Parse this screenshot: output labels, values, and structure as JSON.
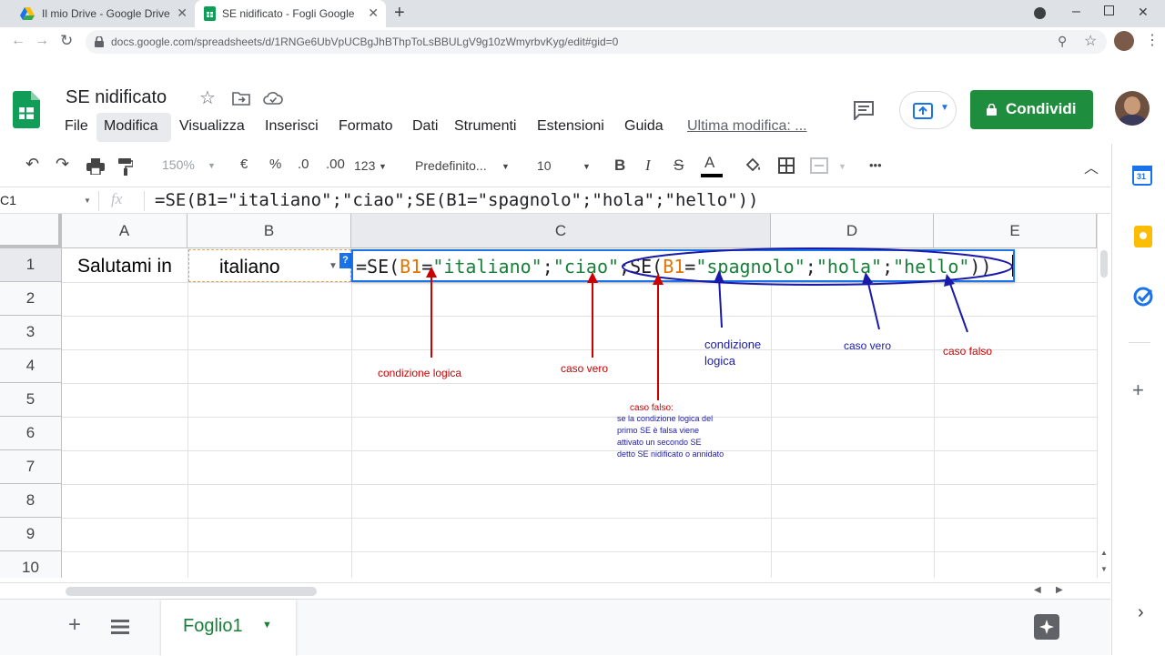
{
  "browser": {
    "tabs": [
      {
        "title": "Il mio Drive - Google Drive"
      },
      {
        "title": "SE nidificato - Fogli Google"
      }
    ],
    "new_tab": "+",
    "url": "docs.google.com/spreadsheets/d/1RNGe6UbVpUCBgJhBThpToLsBBULgV9g10zWmyrbvKyg/edit#gid=0"
  },
  "doc": {
    "title": "SE nidificato",
    "menu": [
      "File",
      "Modifica",
      "Visualizza",
      "Inserisci",
      "Formato",
      "Dati",
      "Strumenti",
      "Estensioni",
      "Guida"
    ],
    "last_edit": "Ultima modifica: ...",
    "share_label": "Condividi"
  },
  "toolbar": {
    "zoom": "150%",
    "currency": "€",
    "percent": "%",
    "dec_less": ".0",
    "dec_more": ".00",
    "more_formats": "123",
    "font": "Predefinito...",
    "font_size": "10",
    "bold": "B",
    "italic": "I",
    "strike": "S",
    "text_color": "A",
    "more": "•••"
  },
  "formula_bar": {
    "cell_ref": "C1",
    "fx": "fx",
    "formula": "=SE(B1=\"italiano\";\"ciao\";SE(B1=\"spagnolo\";\"hola\";\"hello\"))"
  },
  "grid": {
    "columns": [
      "A",
      "B",
      "C",
      "D",
      "E"
    ],
    "rows": [
      "1",
      "2",
      "3",
      "4",
      "5",
      "6",
      "7",
      "8",
      "9",
      "10"
    ],
    "a1": "Salutami in",
    "b1": "italiano",
    "help_badge": "?",
    "c1_parts": [
      {
        "t": "=SE(",
        "c": "#202124"
      },
      {
        "t": "B1",
        "c": "#e37400"
      },
      {
        "t": "=",
        "c": "#202124"
      },
      {
        "t": "\"italiano\"",
        "c": "#188038"
      },
      {
        "t": ";",
        "c": "#202124"
      },
      {
        "t": "\"ciao\"",
        "c": "#188038"
      },
      {
        "t": ";SE(",
        "c": "#202124"
      },
      {
        "t": "B1",
        "c": "#e37400"
      },
      {
        "t": "=",
        "c": "#202124"
      },
      {
        "t": "\"spagnolo\"",
        "c": "#188038"
      },
      {
        "t": ";",
        "c": "#202124"
      },
      {
        "t": "\"hola\"",
        "c": "#188038"
      },
      {
        "t": ";",
        "c": "#202124"
      },
      {
        "t": "\"hello\"",
        "c": "#188038"
      },
      {
        "t": "))",
        "c": "#202124"
      }
    ]
  },
  "annotations": {
    "condizione_logica_1": "condizione logica",
    "caso_vero_1": "caso vero",
    "caso_falso_title": "caso falso:",
    "caso_falso_lines": [
      "se la condizione logica del",
      "primo SE è falsa viene",
      "attivato un secondo SE",
      "detto SE nidificato o annidato"
    ],
    "condizione_logica_2a": "condizione",
    "condizione_logica_2b": "logica",
    "caso_vero_2": "caso vero",
    "caso_falso_2": "caso falso"
  },
  "sheets": {
    "add": "+",
    "tab_name": "Foglio1"
  },
  "colors": {
    "sheets_green": "#188038",
    "share_button": "#1e8e3e",
    "annotation_red": "#cc0000",
    "annotation_blue": "#1a1aaa",
    "selection_blue": "#1a73e8"
  }
}
